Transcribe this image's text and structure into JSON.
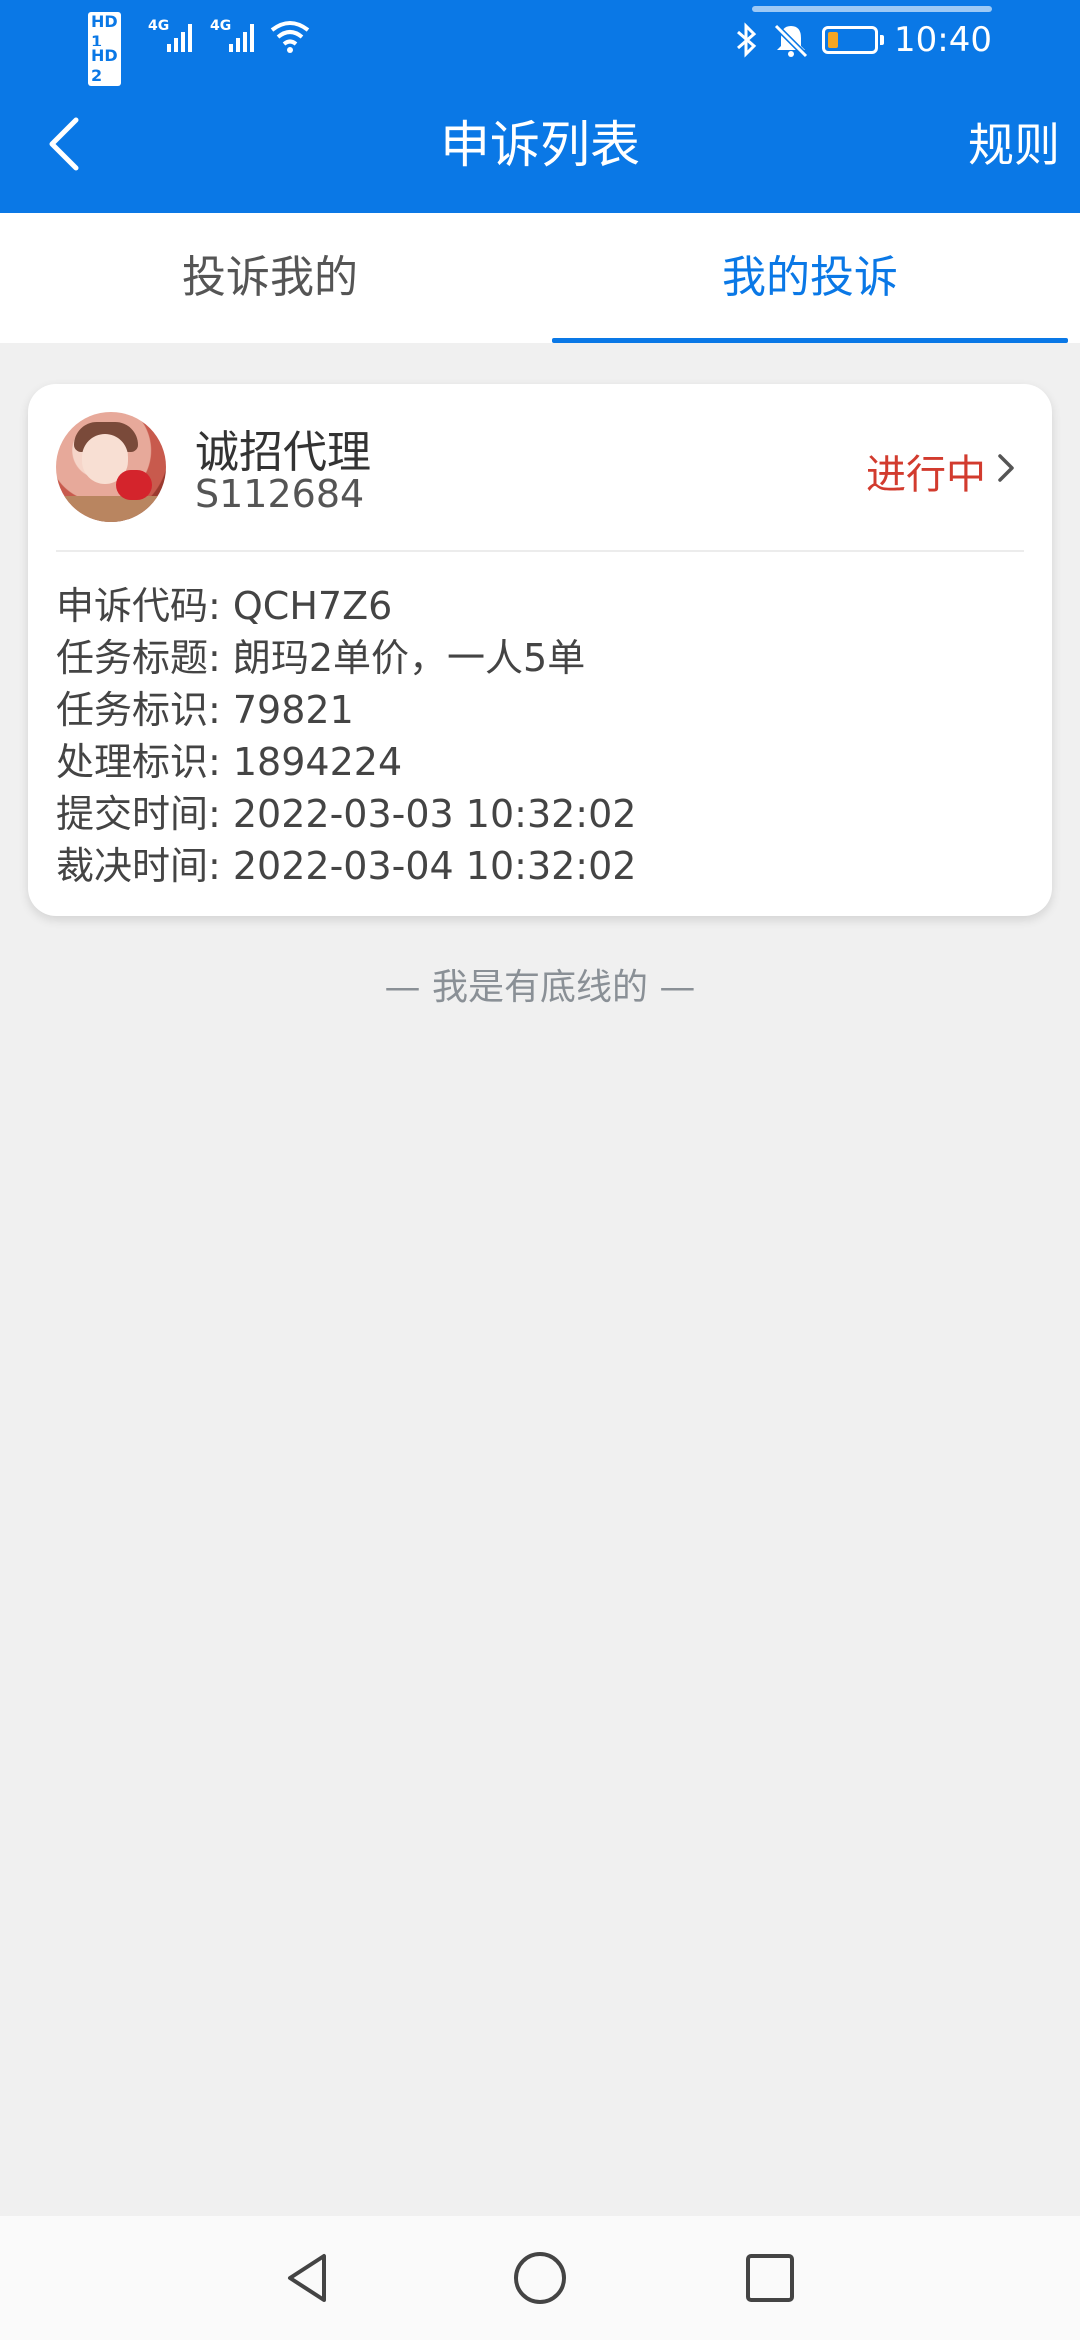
{
  "status_bar": {
    "sim1": "HD 1",
    "sim2": "HD 2",
    "net1": "4G",
    "net2": "4G",
    "time": "10:40",
    "battery_level": 0.2
  },
  "nav": {
    "title": "申诉列表",
    "right_link": "规则"
  },
  "tabs": [
    {
      "label": "投诉我的",
      "active": false
    },
    {
      "label": "我的投诉",
      "active": true
    }
  ],
  "card": {
    "name": "诚招代理",
    "id": "S112684",
    "status": "进行中",
    "rows": [
      "申诉代码: QCH7Z6",
      "任务标题: 朗玛2单价，一人5单",
      "任务标识: 79821",
      "处理标识: 1894224",
      "提交时间: 2022-03-03 10:32:02",
      "裁决时间: 2022-03-04 10:32:02"
    ]
  },
  "footer": "— 我是有底线的 —",
  "colors": {
    "primary": "#0a78e6",
    "status": "#d23b2e"
  }
}
